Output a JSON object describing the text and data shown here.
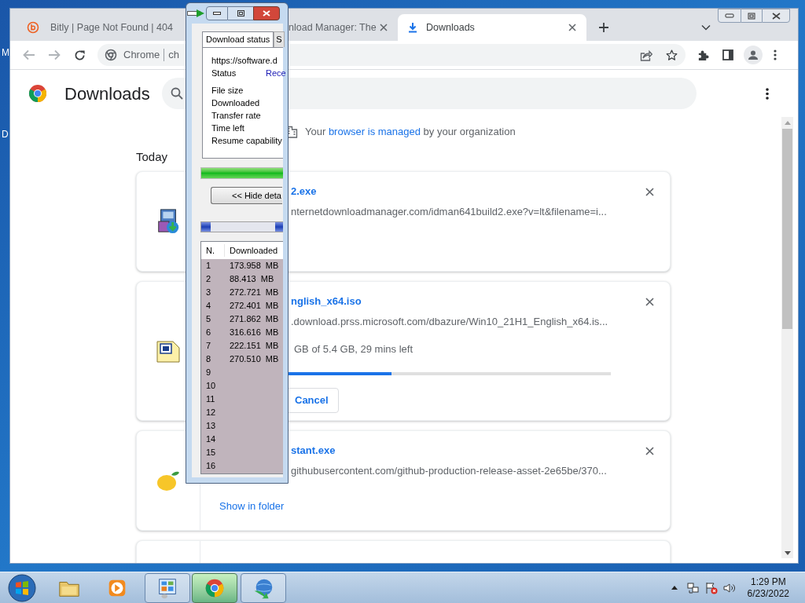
{
  "desktop": {
    "icon_labels": [
      "M",
      "D"
    ]
  },
  "browser": {
    "tabs": [
      {
        "title": "Bitly | Page Not Found | 404",
        "selected": false
      },
      {
        "title": "nload Manager: The",
        "selected": false
      },
      {
        "title": "Downloads",
        "selected": true
      }
    ],
    "omnibox": {
      "chip": "Chrome",
      "url": "ch"
    },
    "page": {
      "title": "Downloads",
      "managed_notice": {
        "before": "Your",
        "link": "browser is managed",
        "after": "by your organization"
      },
      "section": "Today",
      "downloads": [
        {
          "kind": "done",
          "name": "2.exe",
          "url": "nternetdownloadmanager.com/idman641build2.exe?v=lt&filename=i..."
        },
        {
          "kind": "in_progress",
          "name": "nglish_x64.iso",
          "url": ".download.prss.microsoft.com/dbazure/Win10_21H1_English_x64.is...",
          "progress_text": "GB of 5.4 GB, 29 mins left",
          "level": 0.44,
          "action": "Cancel"
        },
        {
          "kind": "done",
          "name": "stant.exe",
          "url": "githubusercontent.com/github-production-release-asset-2e65be/370...",
          "action": "Show in folder"
        }
      ]
    }
  },
  "idm": {
    "tabs": [
      {
        "label": "Download status",
        "selected": true
      },
      {
        "label": "S",
        "selected": false
      }
    ],
    "url": "https://software.d",
    "fields": [
      {
        "label": "Status",
        "value": "Rece"
      },
      {
        "label": "File size"
      },
      {
        "label": "Downloaded"
      },
      {
        "label": "Transfer rate"
      },
      {
        "label": "Time left"
      },
      {
        "label": "Resume capability"
      }
    ],
    "progress": {
      "level": 1
    },
    "hide_button": "<< Hide deta",
    "table": {
      "columns": [
        "N.",
        "Downloaded"
      ],
      "rows": [
        {
          "n": "1",
          "downloaded": "173.958  MB"
        },
        {
          "n": "2",
          "downloaded": "88.413  MB"
        },
        {
          "n": "3",
          "downloaded": "272.721  MB"
        },
        {
          "n": "4",
          "downloaded": "272.401  MB"
        },
        {
          "n": "5",
          "downloaded": "271.862  MB"
        },
        {
          "n": "6",
          "downloaded": "316.616  MB"
        },
        {
          "n": "7",
          "downloaded": "222.151  MB"
        },
        {
          "n": "8",
          "downloaded": "270.510  MB"
        },
        {
          "n": "9"
        },
        {
          "n": "10"
        },
        {
          "n": "11"
        },
        {
          "n": "12"
        },
        {
          "n": "13"
        },
        {
          "n": "14"
        },
        {
          "n": "15"
        },
        {
          "n": "16"
        }
      ]
    }
  },
  "taskbar": {
    "buttons": [
      {
        "running": false,
        "selected": false
      },
      {
        "running": false,
        "selected": false
      },
      {
        "running": true,
        "selected": false
      },
      {
        "running": true,
        "selected": true
      },
      {
        "running": true,
        "selected": false
      }
    ],
    "clock": {
      "time": "1:29 PM",
      "date": "6/23/2022"
    }
  }
}
